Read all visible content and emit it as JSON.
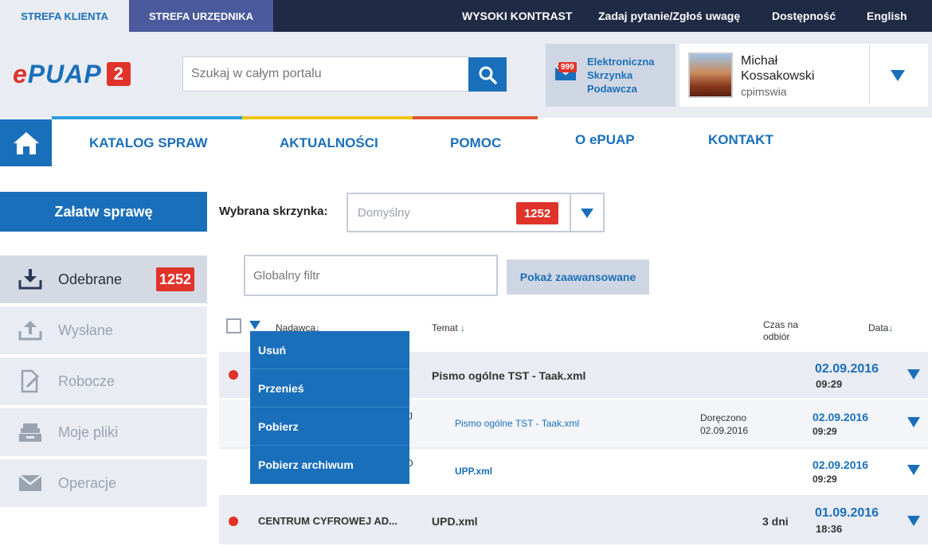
{
  "topbar": {
    "tab_client": "STREFA KLIENTA",
    "tab_official": "STREFA URZĘDNIKA",
    "high_contrast": "WYSOKI KONTRAST",
    "ask": "Zadaj pytanie/Zgłoś uwagę",
    "accessibility": "Dostępność",
    "english": "English"
  },
  "header": {
    "logo_text": "ePUAP",
    "logo_badge": "2",
    "search_placeholder": "Szukaj w całym portalu",
    "inbox_label": "Elektroniczna Skrzynka Podawcza",
    "inbox_badge": "999",
    "user_first": "Michał",
    "user_last": "Kossakowski",
    "user_login": "cpimswia"
  },
  "nav": {
    "items": [
      "KATALOG SPRAW",
      "AKTUALNOŚCI",
      "POMOC",
      "O ePUAP",
      "KONTAKT"
    ]
  },
  "sidebar": {
    "action": "Załatw sprawę",
    "items": [
      {
        "label": "Odebrane",
        "badge": "1252",
        "icon": "download-icon"
      },
      {
        "label": "Wysłane",
        "icon": "upload-icon"
      },
      {
        "label": "Robocze",
        "icon": "draft-edit-icon"
      },
      {
        "label": "Moje pliki",
        "icon": "files-tray-icon"
      },
      {
        "label": "Operacje",
        "icon": "envelope-icon"
      }
    ]
  },
  "mailbox": {
    "label": "Wybrana skrzynka:",
    "value": "Domyślny",
    "badge": "1252"
  },
  "filter": {
    "placeholder": "Globalny filtr",
    "advanced": "Pokaż zaawansowane"
  },
  "table": {
    "col_sender": "Nadawca",
    "col_subject": "Temat",
    "col_time_1": "Czas na",
    "col_time_2": "odbiór",
    "col_date": "Data",
    "sort_marker": "↓",
    "rows": [
      {
        "subject": "Pismo ogólne TST - Taak.xml",
        "date": "02.09.2016",
        "time": "09:29"
      },
      {
        "sender_frag": "J",
        "subject": "Pismo ogólne TST - Taak.xml",
        "status": "Doręczono",
        "status_date": "02.09.2016",
        "date": "02.09.2016",
        "time": "09:29"
      },
      {
        "sender_frag": "D",
        "subject": "UPP.xml",
        "date": "02.09.2016",
        "time": "09:29"
      },
      {
        "sender": "CENTRUM CYFROWEJ AD...",
        "subject": "UPD.xml",
        "time_left": "3 dni",
        "date": "01.09.2016",
        "time": "18:36"
      }
    ]
  },
  "dropdown": {
    "items": [
      "Usuń",
      "Przenieś",
      "Pobierz",
      "Pobierz archiwum"
    ]
  },
  "colors": {
    "primary": "#1a6fba",
    "accent_red": "#e0332a",
    "dark": "#1f2a44",
    "light_bg": "#e9ecf2"
  }
}
